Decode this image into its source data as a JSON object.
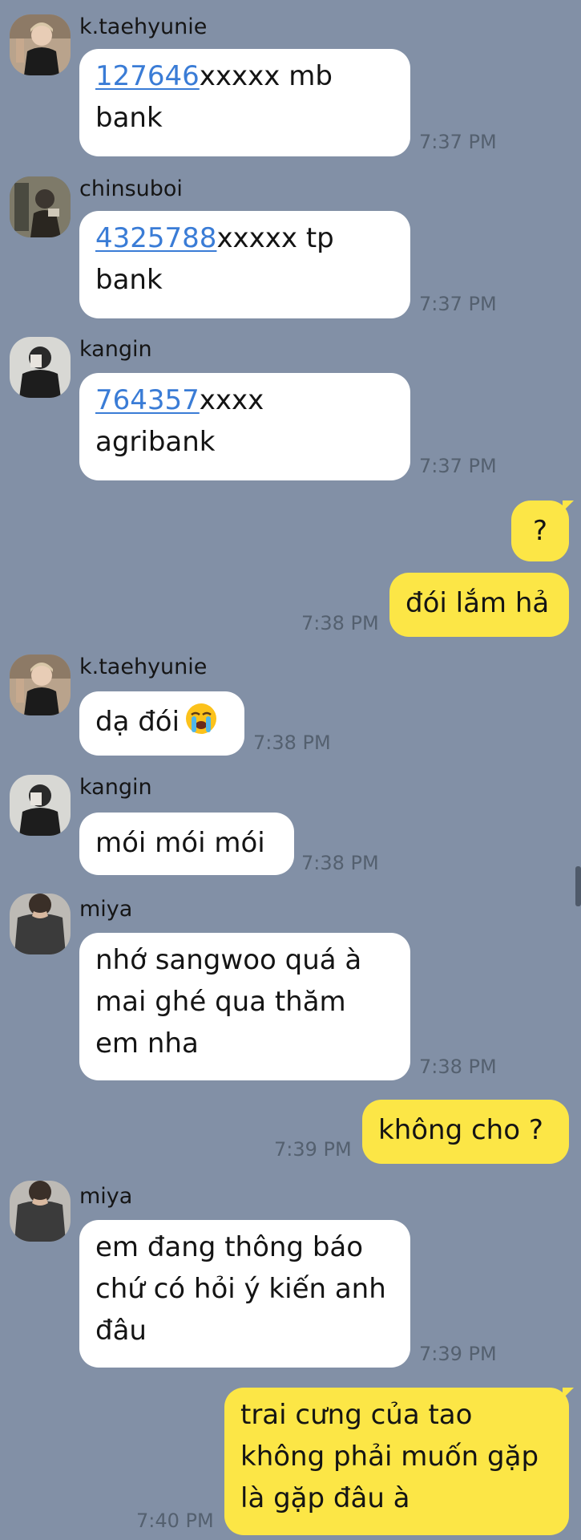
{
  "messages": [
    {
      "sender": "k.taehyunie",
      "avatar_icon": "avatar-ktaehyunie",
      "text_link": "127646",
      "text_rest": "xxxxx mb",
      "text_line2": "bank",
      "time": "7:37 PM"
    },
    {
      "sender": "chinsuboi",
      "avatar_icon": "avatar-chinsuboi",
      "text_link": "4325788",
      "text_rest": "xxxxx tp",
      "text_line2": "bank",
      "time": "7:37 PM"
    },
    {
      "sender": "kangin",
      "avatar_icon": "avatar-kangin",
      "text_link": "764357",
      "text_rest": "xxxx",
      "text_line2": "agribank",
      "time": "7:37 PM"
    },
    {
      "sender": "me",
      "text": "?"
    },
    {
      "sender": "me",
      "text": "đói lắm hả",
      "time": "7:38 PM"
    },
    {
      "sender": "k.taehyunie",
      "avatar_icon": "avatar-ktaehyunie",
      "text": "dạ đói",
      "emoji": "loudly-crying-face-emoji",
      "time": "7:38 PM"
    },
    {
      "sender": "kangin",
      "avatar_icon": "avatar-kangin",
      "text": "mói mói mói",
      "time": "7:38 PM"
    },
    {
      "sender": "miya",
      "avatar_icon": "avatar-miya",
      "lines": [
        "nhớ sangwoo quá à",
        "mai ghé qua thăm",
        "em nha"
      ],
      "time": "7:38 PM"
    },
    {
      "sender": "me",
      "text": "không cho ?",
      "time": "7:39 PM"
    },
    {
      "sender": "miya",
      "avatar_icon": "avatar-miya",
      "lines": [
        "em đang thông báo",
        "chứ có hỏi ý kiến anh",
        "đâu"
      ],
      "time": "7:39 PM"
    },
    {
      "sender": "me",
      "lines": [
        "trai cưng của tao",
        "không phải muốn gặp",
        "là gặp đâu à"
      ],
      "time": "7:40 PM"
    }
  ],
  "colors": {
    "background": "#8290a6",
    "incoming_bubble": "#ffffff",
    "outgoing_bubble": "#fce646",
    "link": "#3a7cd6",
    "timestamp": "#54606f"
  }
}
